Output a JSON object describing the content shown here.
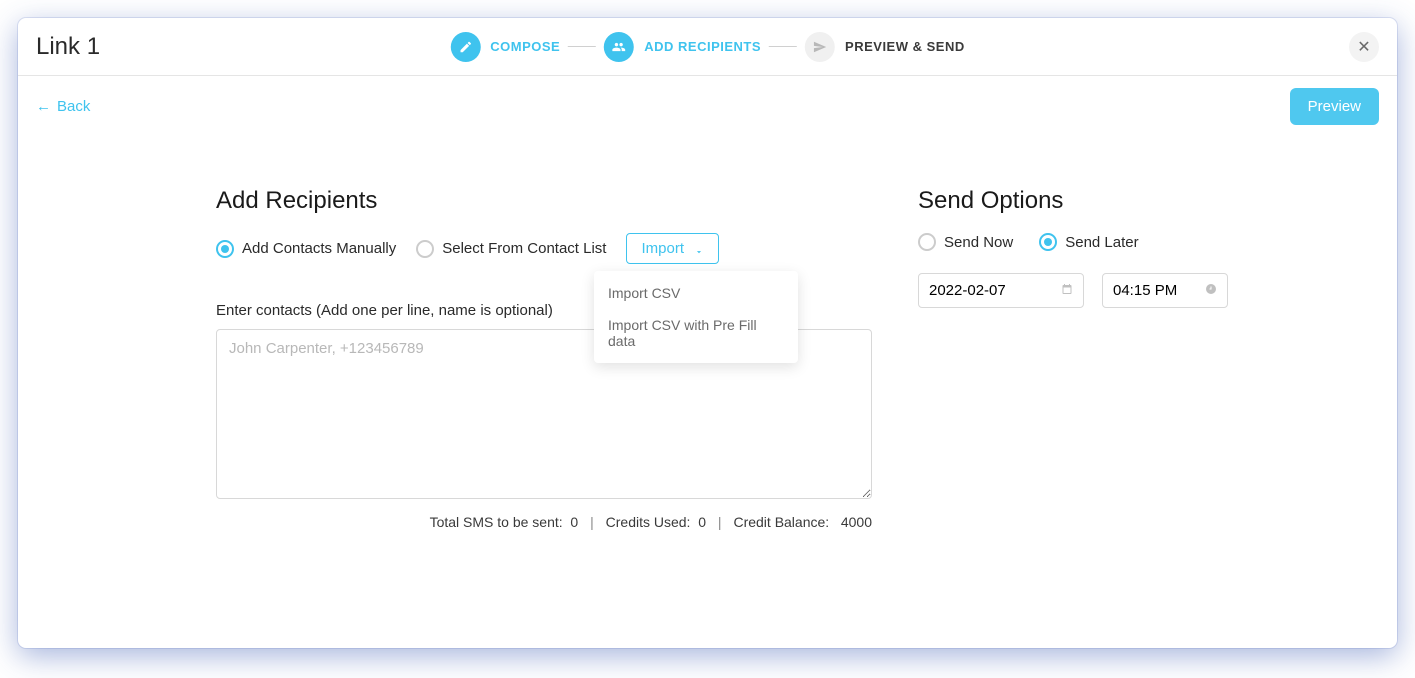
{
  "header": {
    "title": "Link 1",
    "back_label": "Back",
    "preview_button": "Preview"
  },
  "stepper": {
    "compose": "COMPOSE",
    "add_recipients": "ADD RECIPIENTS",
    "preview_send": "PREVIEW & SEND"
  },
  "recipients": {
    "title": "Add Recipients",
    "manual_label": "Add Contacts Manually",
    "select_list_label": "Select From Contact List",
    "import_label": "Import",
    "dropdown": {
      "csv": "Import CSV",
      "csv_prefill": "Import CSV with Pre Fill data"
    },
    "enter_label": "Enter contacts (Add one per line, name is optional)",
    "placeholder": "John Carpenter, +123456789",
    "stats": {
      "total_label": "Total SMS to be sent:",
      "total_value": "0",
      "credits_used_label": "Credits Used:",
      "credits_used_value": "0",
      "credit_balance_label": "Credit Balance:",
      "credit_balance_value": "4000"
    }
  },
  "send_options": {
    "title": "Send Options",
    "now_label": "Send Now",
    "later_label": "Send Later",
    "date_value": "2022-02-07",
    "time_value": "04:15 PM"
  }
}
